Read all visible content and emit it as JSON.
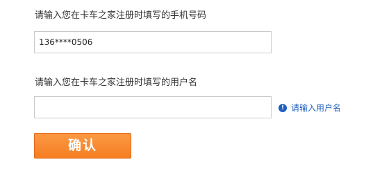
{
  "phone_section": {
    "label": "请输入您在卡车之家注册时填写的手机号码",
    "value": "136****0506"
  },
  "username_section": {
    "label": "请输入您在卡车之家注册时填写的用户名",
    "value": "",
    "hint_icon": "exclamation-circle-icon",
    "hint_text": "请输入用户名"
  },
  "actions": {
    "confirm_label": "确认"
  },
  "colors": {
    "button": "#f57d22",
    "hint": "#1f5fbf"
  }
}
